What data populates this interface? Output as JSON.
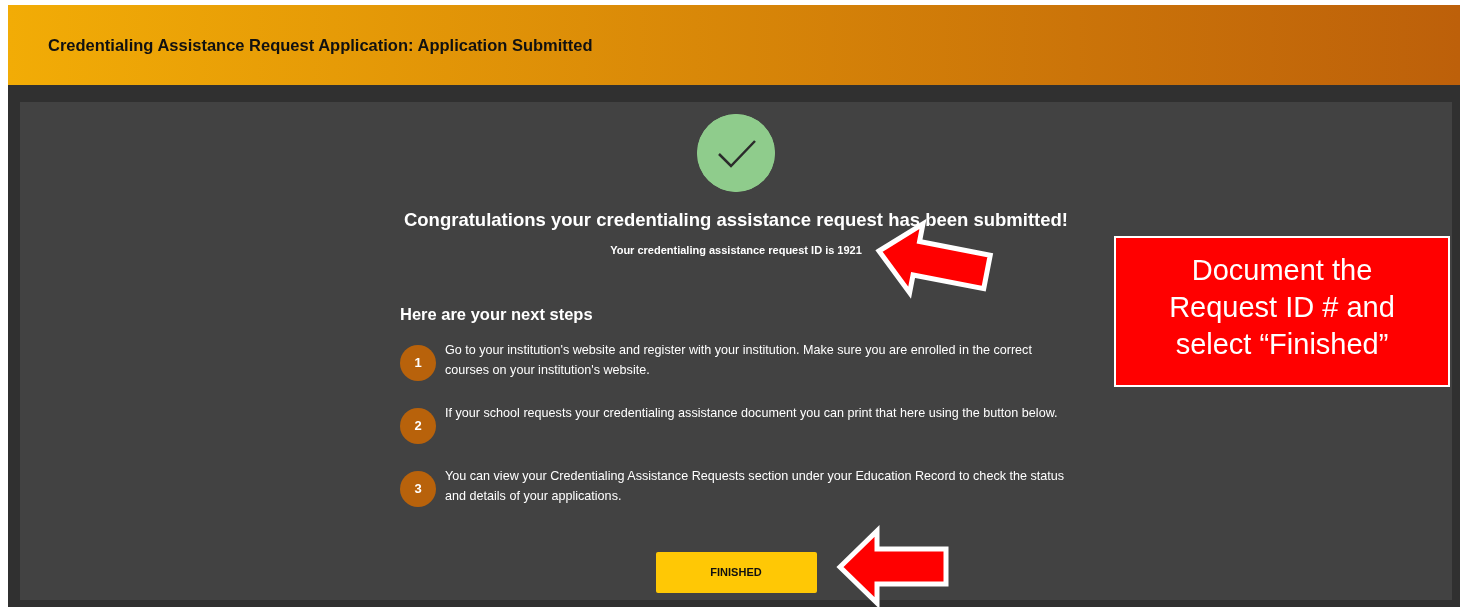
{
  "header": {
    "title": "Credentialing Assistance Request Application: Application Submitted"
  },
  "confirmation": {
    "message": "Congratulations your credentialing assistance request has been submitted!",
    "request_id_text": "Your credentialing assistance request ID is 1921"
  },
  "next_steps": {
    "heading": "Here are your next steps",
    "steps": [
      {
        "number": "1",
        "text": "Go to your institution's website and register with your institution. Make sure you are enrolled in the correct courses on your institution's website."
      },
      {
        "number": "2",
        "text": "If your school requests your credentialing assistance document you can print that here using the button below."
      },
      {
        "number": "3",
        "text": "You can view your Credentialing Assistance Requests section under your Education Record to check the status and details of your applications."
      }
    ]
  },
  "button": {
    "label": "FINISHED"
  },
  "annotation": {
    "note": "Document the Request ID # and select “Finished”"
  }
}
